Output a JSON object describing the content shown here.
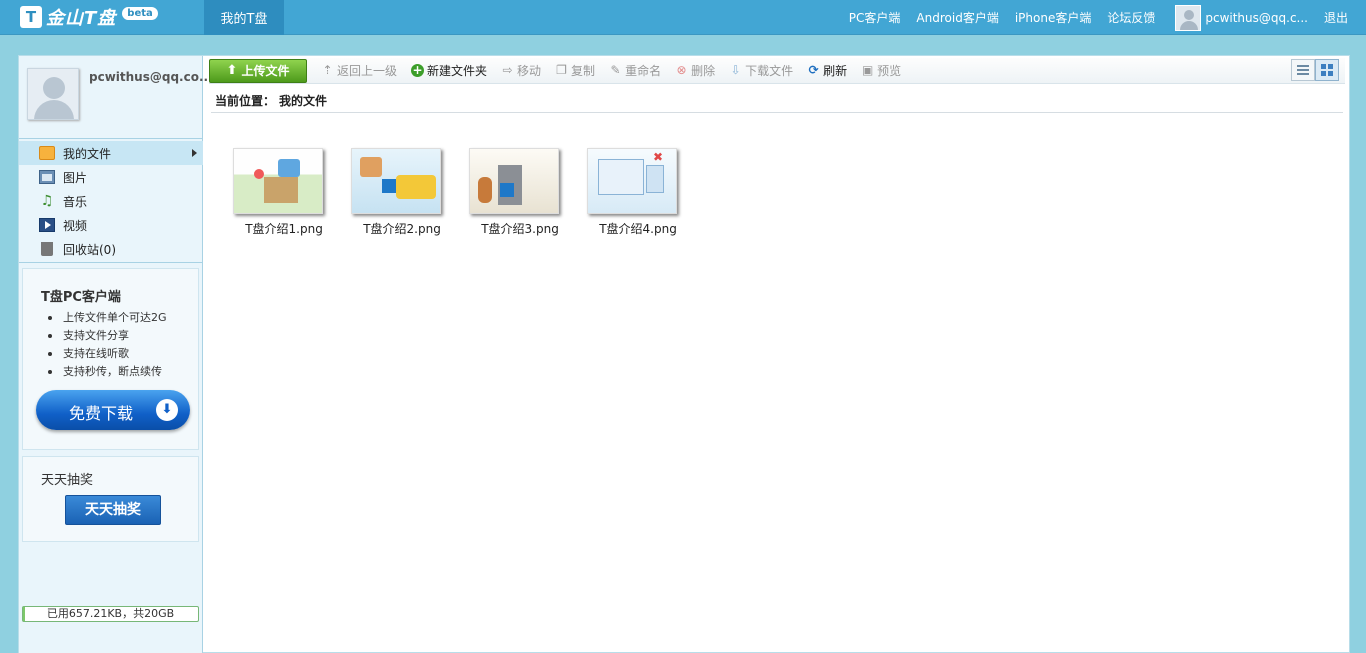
{
  "topbar": {
    "logo_text": "金山T盘",
    "logo_badge": "beta",
    "active_tab": "我的T盘",
    "links": [
      "PC客户端",
      "Android客户端",
      "iPhone客户端",
      "论坛反馈"
    ],
    "user": "pcwithus@qq.c...",
    "logout": "退出"
  },
  "sidebar": {
    "profile_name": "pcwithus@qq.co...",
    "nav": [
      {
        "label": "我的文件",
        "icon": "folder-icon"
      },
      {
        "label": "图片",
        "icon": "picture-icon"
      },
      {
        "label": "音乐",
        "icon": "music-icon"
      },
      {
        "label": "视频",
        "icon": "video-icon"
      },
      {
        "label": "回收站(0)",
        "icon": "trash-icon"
      }
    ],
    "promo": {
      "title": "T盘PC客户端",
      "items": [
        "上传文件单个可达2G",
        "支持文件分享",
        "支持在线听歌",
        "支持秒传，断点续传"
      ],
      "download_label": "免费下载"
    },
    "lottery": {
      "title": "天天抽奖",
      "button_label": "天天抽奖"
    },
    "quota": {
      "text": "已用657.21KB，共20GB",
      "used_fraction": 3e-05
    }
  },
  "toolbar": {
    "upload_label": "上传文件",
    "actions": [
      {
        "label": "返回上一级",
        "enabled": false,
        "icon": "back-icon"
      },
      {
        "label": "新建文件夹",
        "enabled": true,
        "icon": "new-folder-icon"
      },
      {
        "label": "移动",
        "enabled": false,
        "icon": "move-icon"
      },
      {
        "label": "复制",
        "enabled": false,
        "icon": "copy-icon"
      },
      {
        "label": "重命名",
        "enabled": false,
        "icon": "rename-icon"
      },
      {
        "label": "删除",
        "enabled": false,
        "icon": "delete-icon"
      },
      {
        "label": "下载文件",
        "enabled": false,
        "icon": "download-icon"
      },
      {
        "label": "刷新",
        "enabled": true,
        "icon": "refresh-icon"
      },
      {
        "label": "预览",
        "enabled": false,
        "icon": "preview-icon"
      }
    ],
    "view_mode": "grid"
  },
  "breadcrumb": {
    "label": "当前位置：",
    "current": "我的文件"
  },
  "files": [
    {
      "name": "T盘介绍1.png"
    },
    {
      "name": "T盘介绍2.png"
    },
    {
      "name": "T盘介绍3.png"
    },
    {
      "name": "T盘介绍4.png"
    }
  ],
  "colors": {
    "topbar": "#42a6d4",
    "background": "#8fd0e0",
    "upload_button": "#5aad24",
    "download_button": "#1060c8"
  }
}
